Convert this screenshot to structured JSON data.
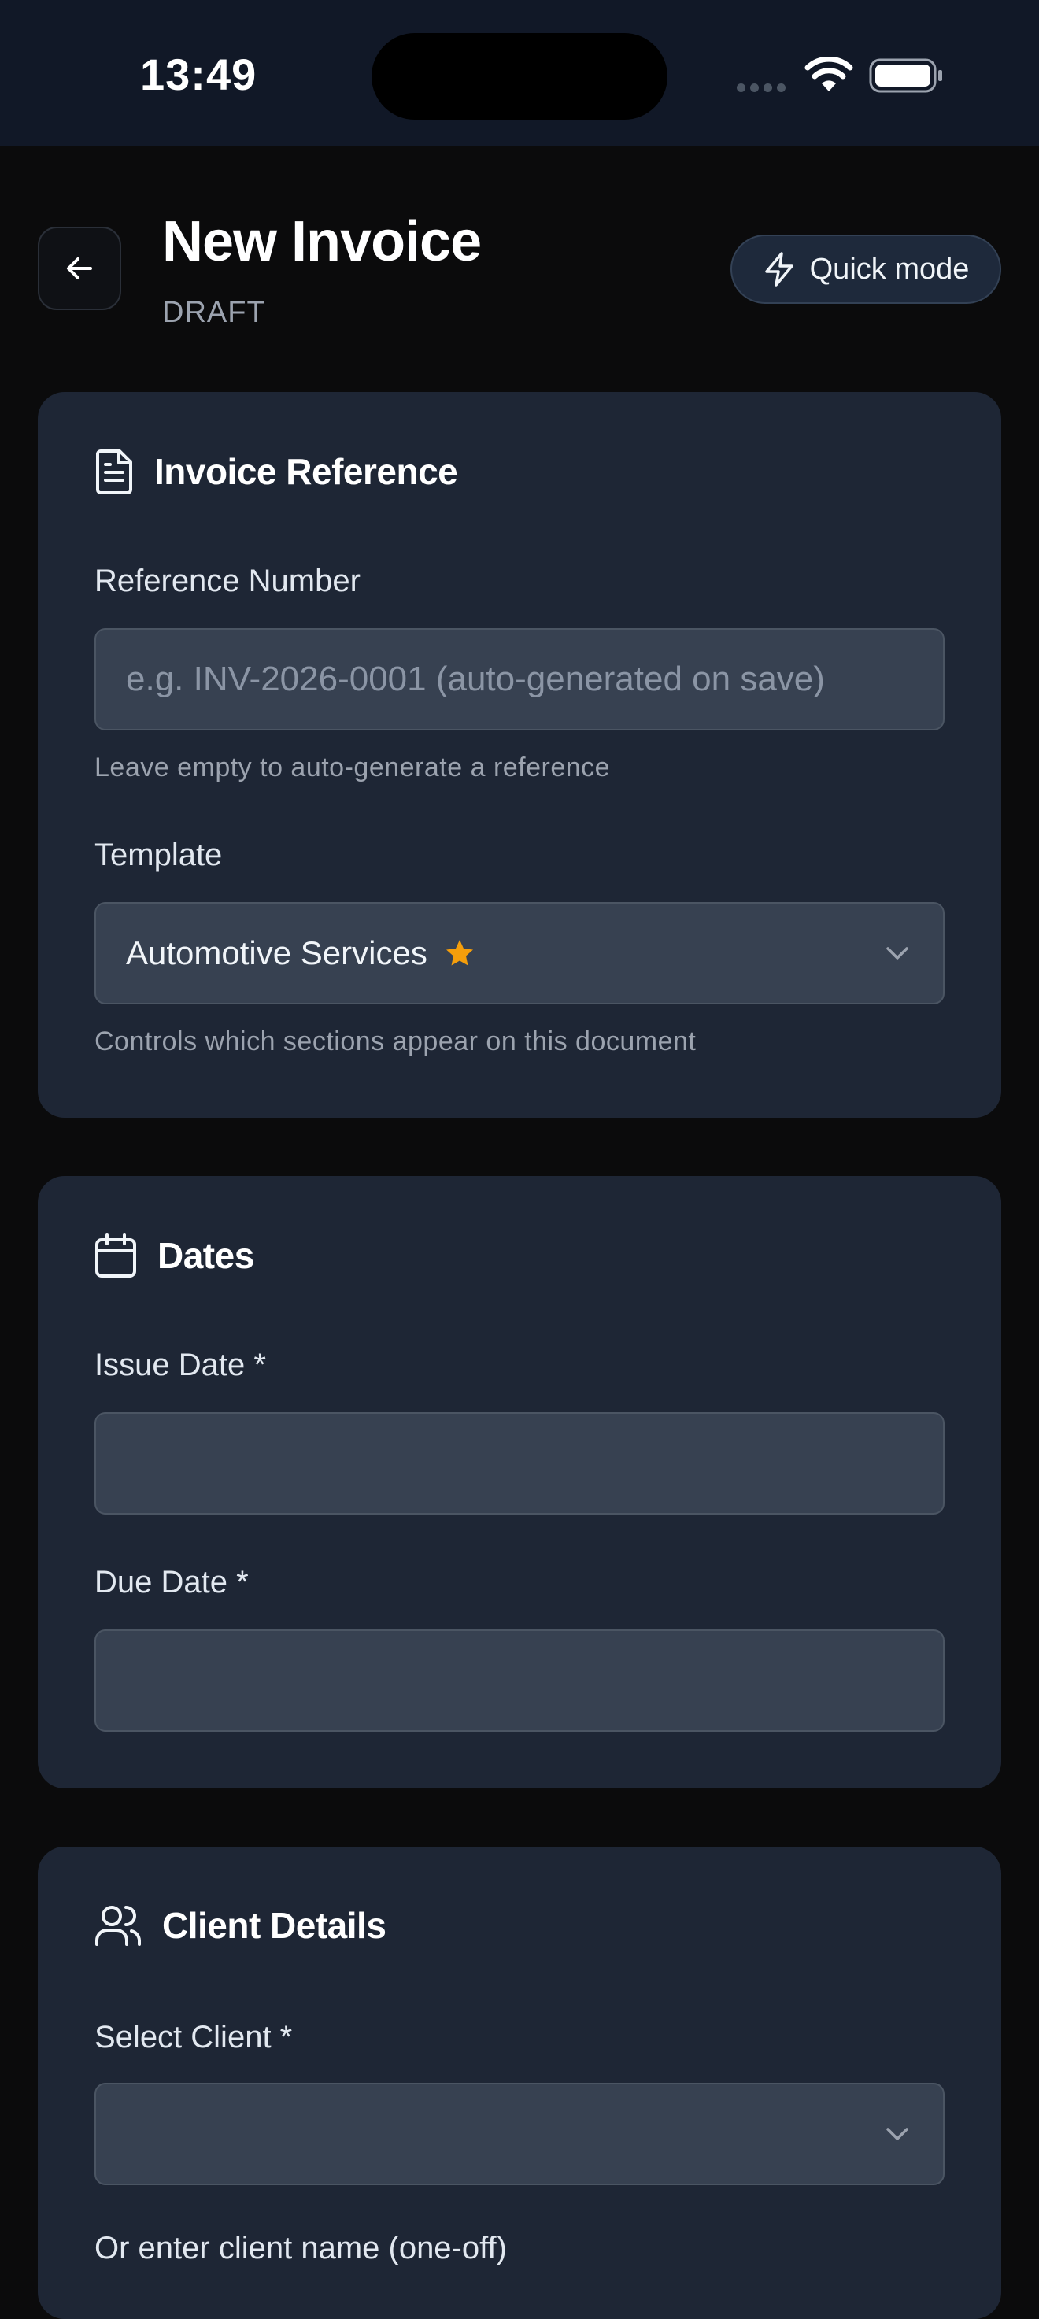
{
  "status_bar": {
    "time": "13:49"
  },
  "header": {
    "title": "New Invoice",
    "subtitle": "DRAFT",
    "quick_mode_label": "Quick mode"
  },
  "invoice_reference": {
    "title": "Invoice Reference",
    "reference_label": "Reference Number",
    "reference_placeholder": "e.g. INV-2026-0001 (auto-generated on save)",
    "reference_help": "Leave empty to auto-generate a reference",
    "template_label": "Template",
    "template_value": "Automotive Services",
    "template_help": "Controls which sections appear on this document"
  },
  "dates": {
    "title": "Dates",
    "issue_label": "Issue Date *",
    "issue_value": "",
    "due_label": "Due Date *",
    "due_value": ""
  },
  "client_details": {
    "title": "Client Details",
    "select_label": "Select Client *",
    "select_value": "",
    "oneoff_label": "Or enter client name (one-off)"
  },
  "colors": {
    "background": "#0b0b0c",
    "card": "#1e2635",
    "input": "#374151",
    "star": "#f59e0b"
  },
  "icons": [
    "arrow-left-icon",
    "lightning-icon",
    "document-icon",
    "star-icon",
    "chevron-down-icon",
    "calendar-icon",
    "users-icon",
    "wifi-icon",
    "battery-icon"
  ]
}
